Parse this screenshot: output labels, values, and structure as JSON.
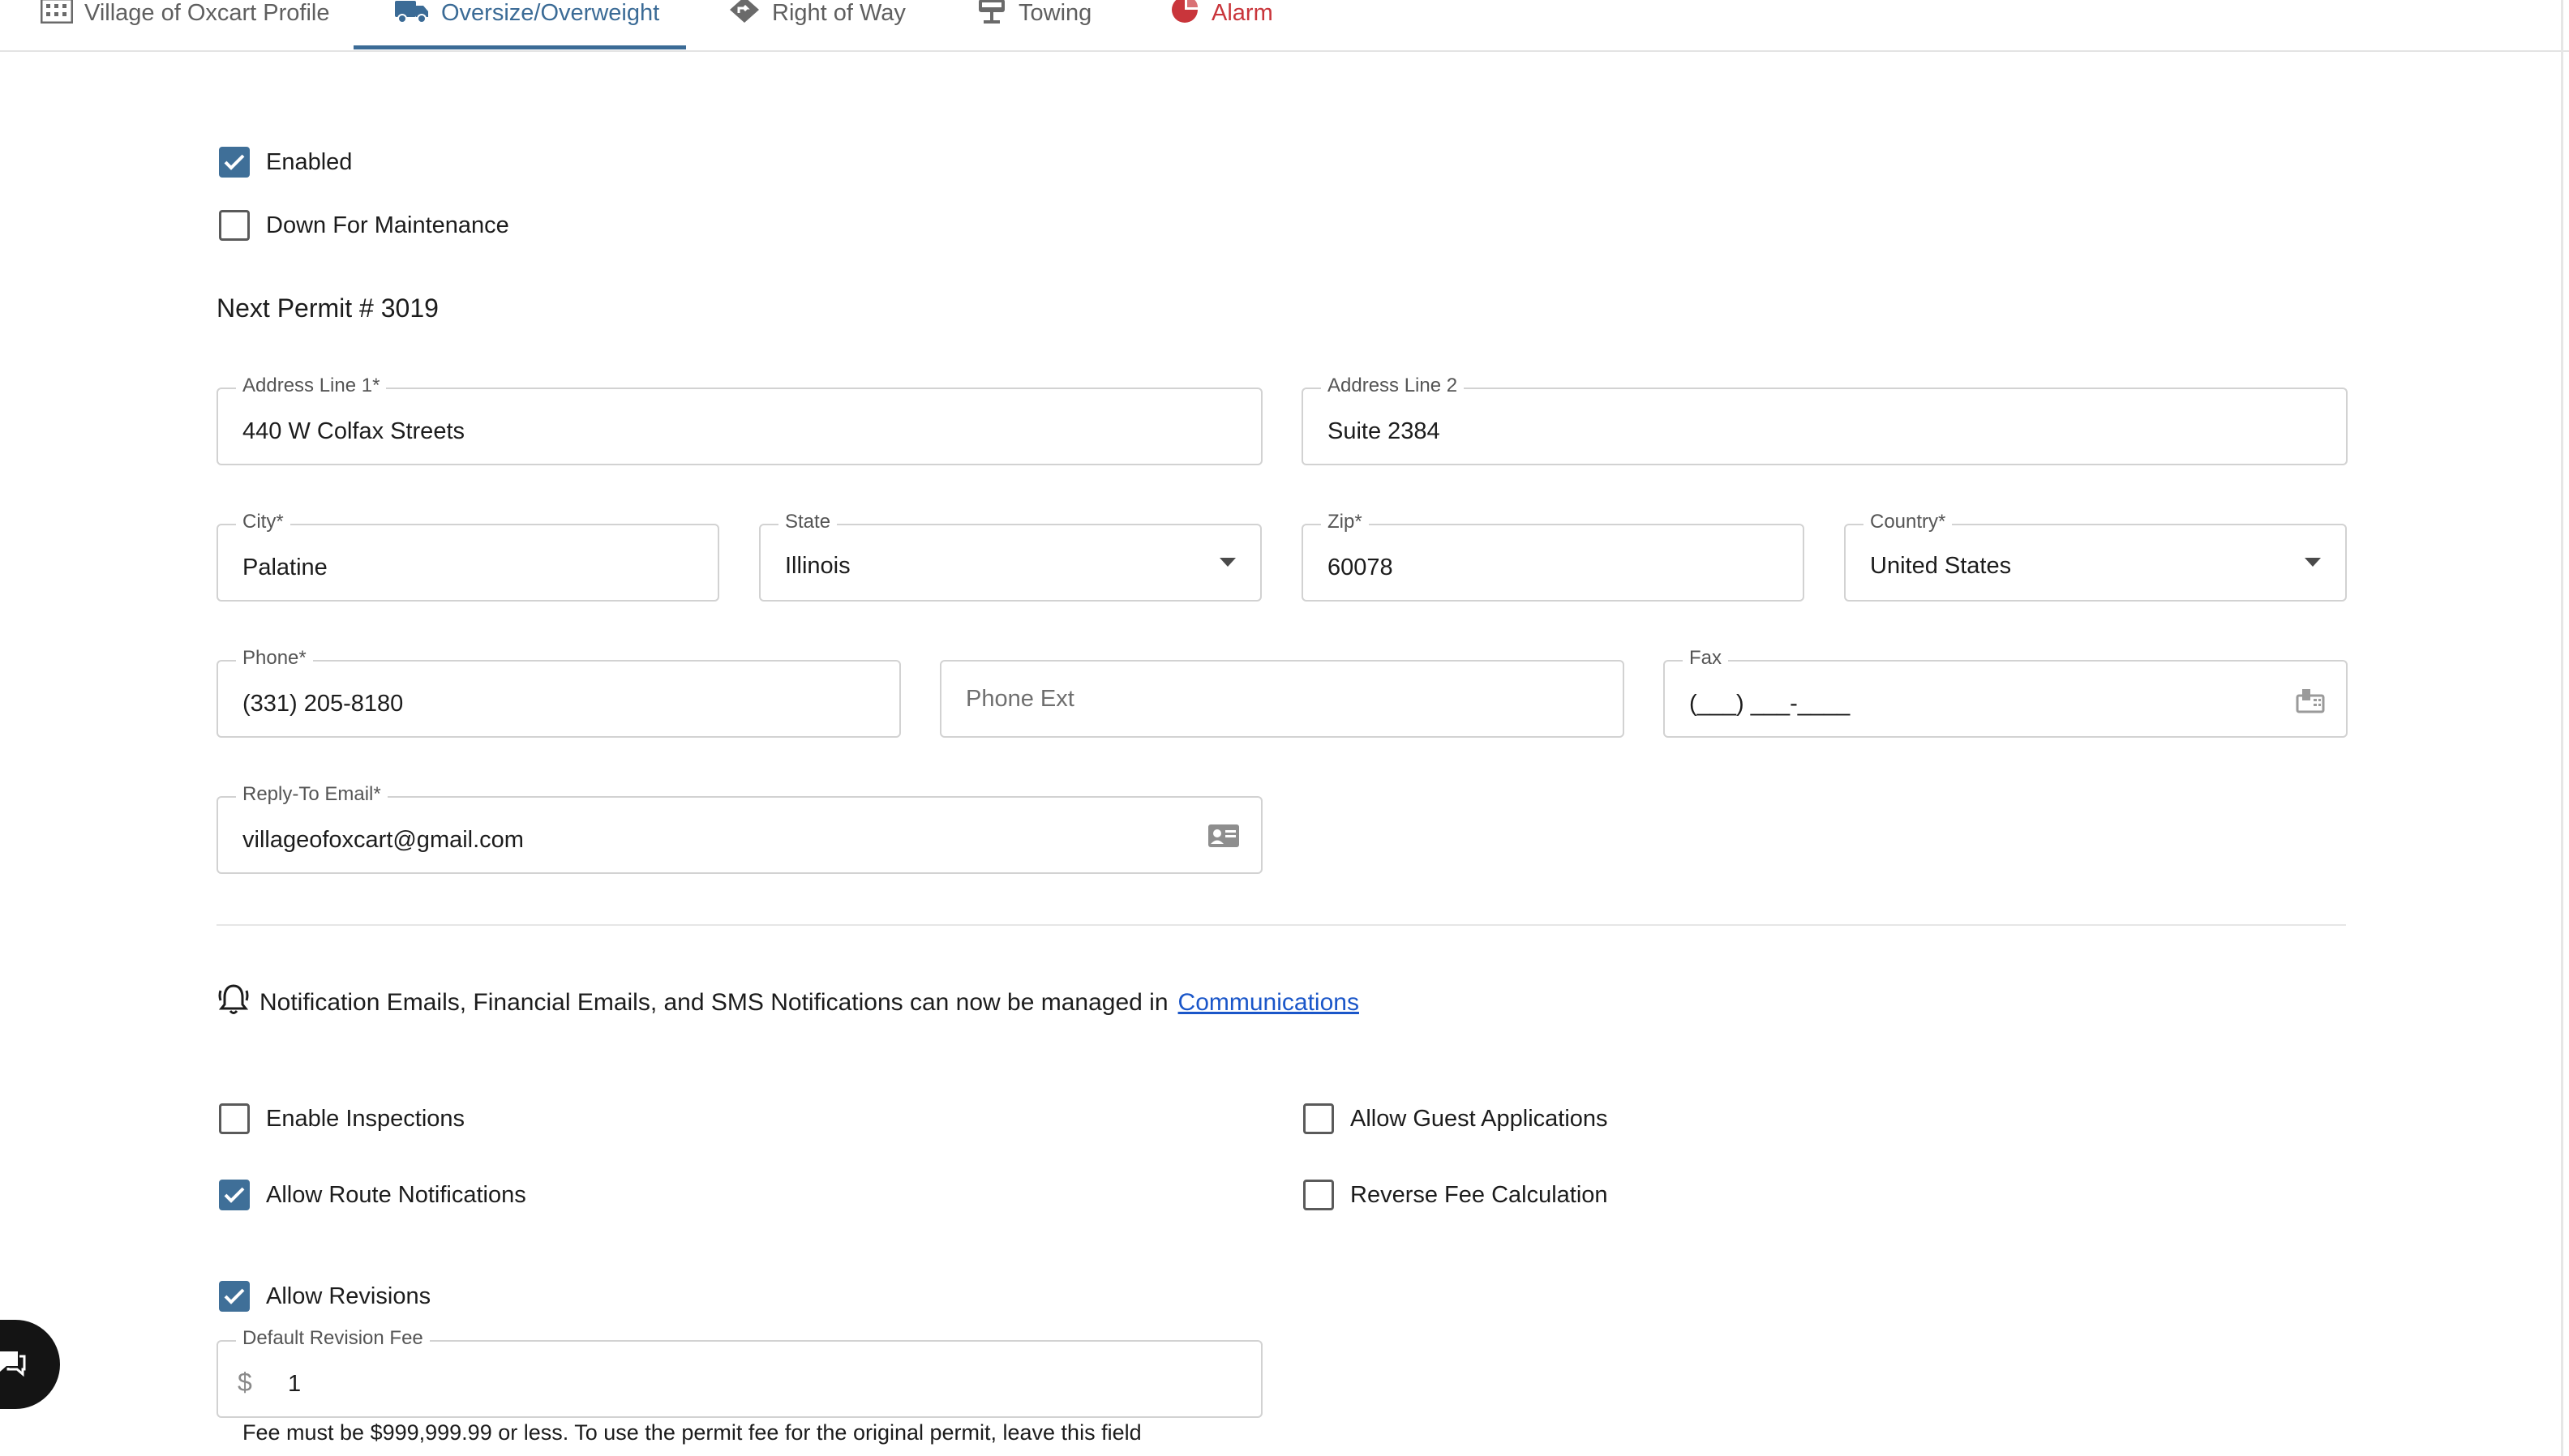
{
  "tabs": [
    {
      "label": "Village of Oxcart Profile",
      "icon": "building-icon",
      "active": false
    },
    {
      "label": "Oversize/Overweight",
      "icon": "truck-icon",
      "active": true
    },
    {
      "label": "Right of Way",
      "icon": "directions-sign-icon",
      "active": false
    },
    {
      "label": "Towing",
      "icon": "tow-truck-icon",
      "active": false
    },
    {
      "label": "Alarm",
      "icon": "alarm-icon",
      "active": false
    }
  ],
  "status": {
    "enabled_label": "Enabled",
    "enabled_checked": true,
    "maintenance_label": "Down For Maintenance",
    "maintenance_checked": false
  },
  "next_permit": "Next Permit # 3019",
  "address": {
    "line1_label": "Address Line 1*",
    "line1_value": "440 W Colfax Streets",
    "line2_label": "Address Line 2",
    "line2_value": "Suite 2384",
    "city_label": "City*",
    "city_value": "Palatine",
    "state_label": "State",
    "state_value": "Illinois",
    "zip_label": "Zip*",
    "zip_value": "60078",
    "country_label": "Country*",
    "country_value": "United States"
  },
  "contact": {
    "phone_label": "Phone*",
    "phone_value": "(331) 205-8180",
    "phone_ext_placeholder": "Phone Ext",
    "fax_label": "Fax",
    "fax_value": "(___) ___-____",
    "email_label": "Reply-To Email*",
    "email_value": "villageofoxcart@gmail.com"
  },
  "notice": {
    "text": "Notification Emails, Financial Emails, and SMS Notifications can now be managed in",
    "link": "Communications"
  },
  "options": {
    "enable_inspections": {
      "label": "Enable Inspections",
      "checked": false
    },
    "allow_guest_applications": {
      "label": "Allow Guest Applications",
      "checked": false
    },
    "allow_route_notifications": {
      "label": "Allow Route Notifications",
      "checked": true
    },
    "reverse_fee_calculation": {
      "label": "Reverse Fee Calculation",
      "checked": false
    },
    "allow_revisions": {
      "label": "Allow Revisions",
      "checked": true
    }
  },
  "revision_fee": {
    "label": "Default Revision Fee",
    "currency_symbol": "$",
    "value": "1",
    "helper": "Fee must be $999,999.99 or less. To use the permit fee for the original permit, leave this field"
  },
  "colors": {
    "accent": "#3b6b96",
    "alarm": "#c9353b",
    "link": "#1a56c9"
  }
}
